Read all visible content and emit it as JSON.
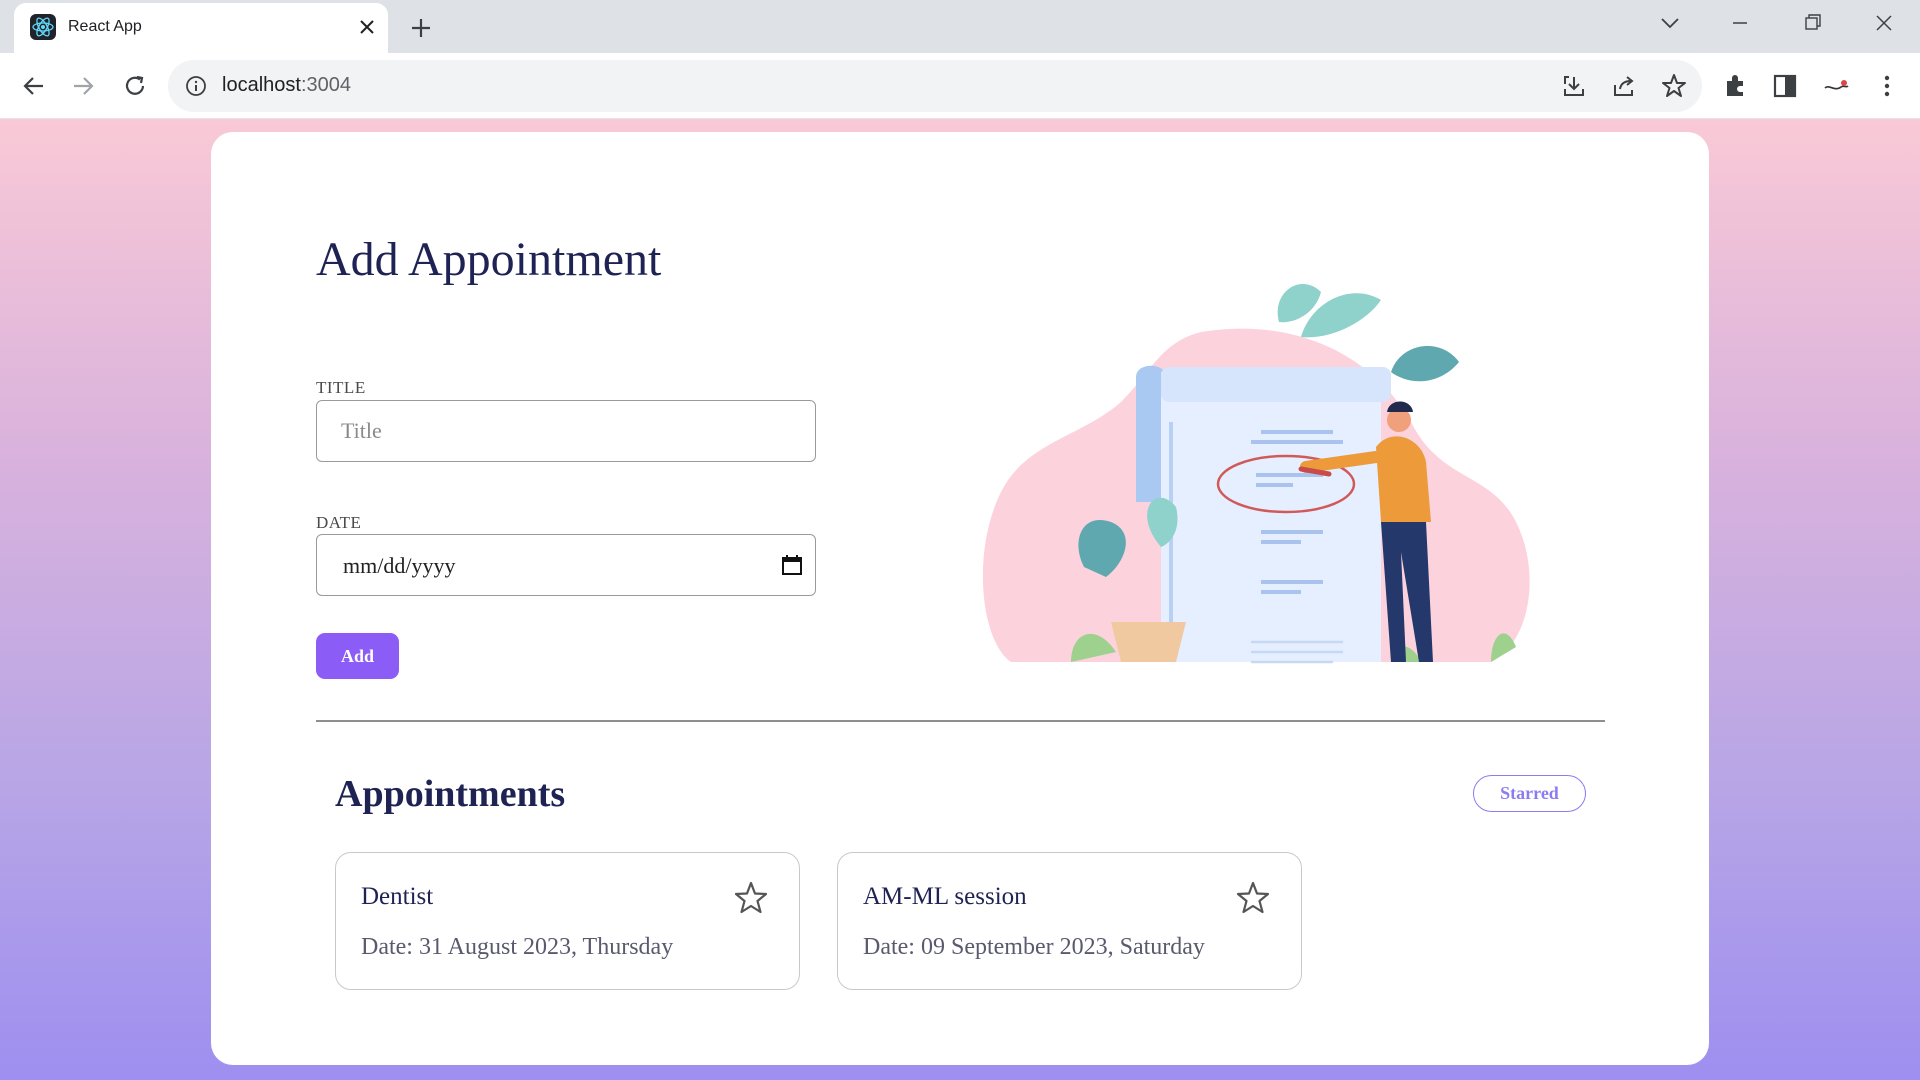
{
  "browser": {
    "tab_title": "React App",
    "url_host": "localhost",
    "url_port": ":3004"
  },
  "form": {
    "title": "Add Appointment",
    "title_label": "TITLE",
    "title_placeholder": "Title",
    "date_label": "DATE",
    "date_placeholder": "mm/dd/yyyy",
    "add_label": "Add"
  },
  "list": {
    "title": "Appointments",
    "starred_label": "Starred",
    "items": [
      {
        "title": "Dentist",
        "date": "Date: 31 August 2023, Thursday",
        "starred": false
      },
      {
        "title": "AM-ML session",
        "date": "Date: 09 September 2023, Saturday",
        "starred": false
      }
    ]
  },
  "colors": {
    "accent": "#8b5cf6",
    "heading": "#1f2354",
    "starred_outline": "#8b7cf0"
  },
  "icons": [
    "react-icon",
    "close-icon",
    "plus-icon",
    "chevron-down-icon",
    "minimize-icon",
    "restore-icon",
    "close-window-icon",
    "back-icon",
    "forward-icon",
    "reload-icon",
    "info-icon",
    "install-icon",
    "share-icon",
    "bookmark-star-icon",
    "extensions-icon",
    "side-panel-icon",
    "profile-icon",
    "menu-icon",
    "calendar-icon",
    "star-icon"
  ]
}
